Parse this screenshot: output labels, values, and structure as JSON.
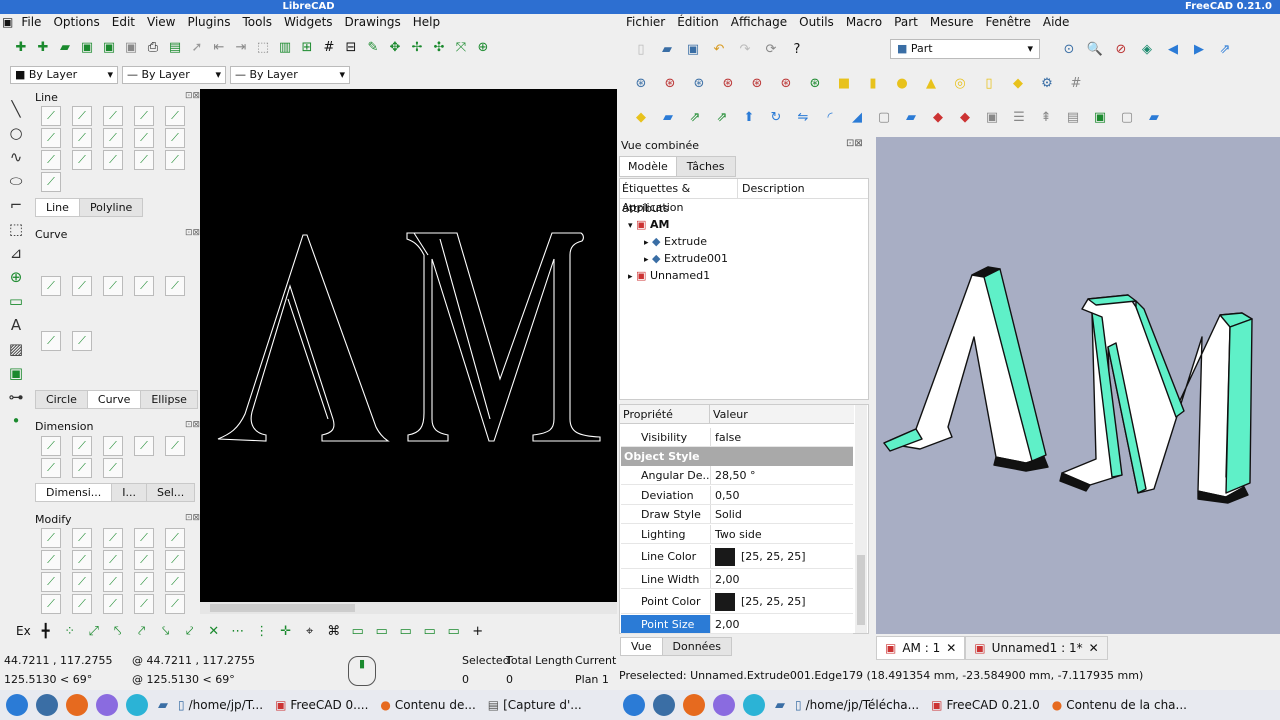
{
  "libre": {
    "title": "LibreCAD",
    "menu": [
      "File",
      "Options",
      "Edit",
      "View",
      "Plugins",
      "Tools",
      "Widgets",
      "Drawings",
      "Help"
    ],
    "combos": [
      "By Layer",
      "By Layer",
      "By Layer"
    ],
    "line_dock": {
      "title": "Line",
      "tabs": [
        "Line",
        "Polyline"
      ]
    },
    "curve_dock": {
      "title": "Curve",
      "tabs": [
        "Circle",
        "Curve",
        "Ellipse"
      ]
    },
    "dim_dock": {
      "title": "Dimension",
      "tabs": [
        "Dimensi...",
        "I...",
        "Sel..."
      ]
    },
    "modify_dock": {
      "title": "Modify"
    },
    "status": {
      "coord1": "44.7211 , 117.2755",
      "coord2": "125.5130 < 69°",
      "rel1": "@ 44.7211 , 117.2755",
      "rel2": "@ 125.5130 < 69°",
      "selected_label": "Selected",
      "selected_val": "0",
      "total_label": "Total Length",
      "total_val": "0",
      "current_label": "Current",
      "current_val": "Plan 1"
    },
    "snap_label": "Ex"
  },
  "free": {
    "title": "FreeCAD 0.21.0",
    "menu": [
      "Fichier",
      "Édition",
      "Affichage",
      "Outils",
      "Macro",
      "Part",
      "Mesure",
      "Fenêtre",
      "Aide"
    ],
    "workbench": "Part",
    "combo_title": "Vue combinée",
    "tabs": [
      "Modèle",
      "Tâches"
    ],
    "subtabs": [
      "Étiquettes & attributs",
      "Description"
    ],
    "tree": {
      "root": "Application",
      "doc": "AM",
      "children": [
        "Extrude",
        "Extrude001"
      ],
      "other": "Unnamed1"
    },
    "prop_header": {
      "k": "Propriété",
      "v": "Valeur"
    },
    "props": [
      {
        "k": "Visibility",
        "v": "false"
      },
      {
        "k": "Angular De...",
        "v": "28,50 °"
      },
      {
        "k": "Deviation",
        "v": "0,50"
      },
      {
        "k": "Draw Style",
        "v": "Solid"
      },
      {
        "k": "Lighting",
        "v": "Two side"
      },
      {
        "k": "Line Color",
        "v": "[25, 25, 25]"
      },
      {
        "k": "Line Width",
        "v": "2,00"
      },
      {
        "k": "Point Color",
        "v": "[25, 25, 25]"
      },
      {
        "k": "Point Size",
        "v": "2,00"
      }
    ],
    "group": "Object Style",
    "bottom_tabs": [
      "Vue",
      "Données"
    ],
    "view_tabs": [
      "AM : 1",
      "Unnamed1 : 1*"
    ],
    "status": "Preselected: Unnamed.Extrude001.Edge179 (18.491354 mm, -23.584900 mm, -7.117935 mm)"
  },
  "taskbar": {
    "left": [
      "/home/jp/T...",
      "FreeCAD 0....",
      "Contenu de...",
      "[Capture d'..."
    ],
    "right": [
      "/home/jp/Télécha...",
      "FreeCAD 0.21.0",
      "Contenu de la cha..."
    ]
  },
  "colors": {
    "title": "#2d6fd1",
    "accent": "#1b8a2e",
    "extrude": "#5ff0c8",
    "view_bg": "#a8aec4"
  }
}
